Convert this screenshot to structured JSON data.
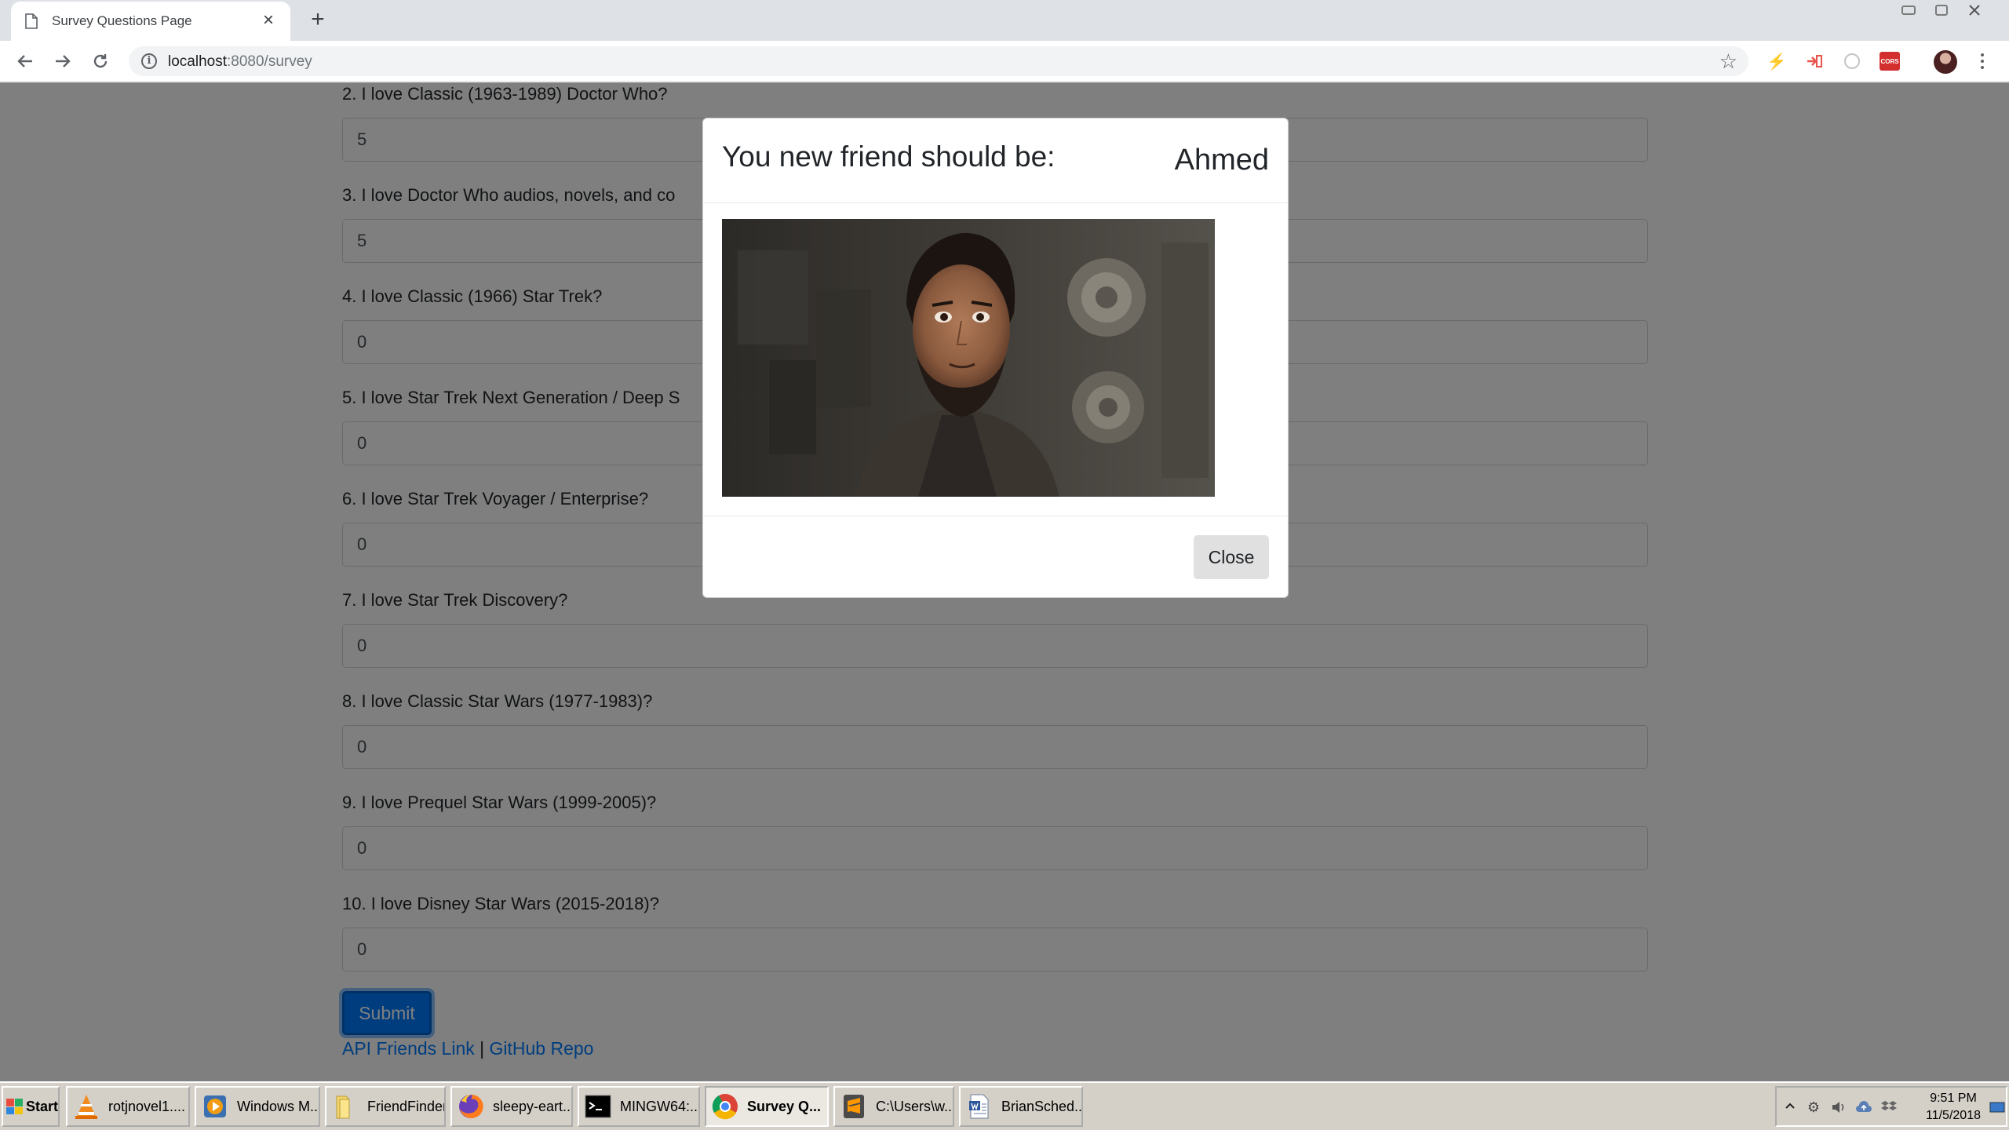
{
  "browser": {
    "tab_title": "Survey Questions Page",
    "url_host": "localhost",
    "url_rest": ":8080/survey",
    "new_tab_label": "+",
    "close_tab_label": "×"
  },
  "survey": {
    "questions": [
      {
        "label": "2. I love Classic (1963-1989) Doctor Who?",
        "value": "5"
      },
      {
        "label": "3. I love Doctor Who audios, novels, and co",
        "value": "5"
      },
      {
        "label": "4. I love Classic (1966) Star Trek?",
        "value": "0"
      },
      {
        "label": "5. I love Star Trek Next Generation / Deep S",
        "value": "0"
      },
      {
        "label": "6. I love Star Trek Voyager / Enterprise?",
        "value": "0"
      },
      {
        "label": "7. I love Star Trek Discovery?",
        "value": "0"
      },
      {
        "label": "8. I love Classic Star Wars (1977-1983)?",
        "value": "0"
      },
      {
        "label": "9. I love Prequel Star Wars (1999-2005)?",
        "value": "0"
      },
      {
        "label": "10. I love Disney Star Wars (2015-2018)?",
        "value": "0"
      }
    ],
    "submit_label": "Submit",
    "links": {
      "api_label": "API Friends Link",
      "separator": " | ",
      "github_label": "GitHub Repo"
    }
  },
  "modal": {
    "title": "You new friend should be:",
    "friend_name": "Ahmed",
    "close_label": "Close"
  },
  "taskbar": {
    "start_label": "Start",
    "items": [
      {
        "label": "rotjnovel1....",
        "icon": "vlc-icon"
      },
      {
        "label": "Windows M...",
        "icon": "media-player-icon"
      },
      {
        "label": "FriendFinder",
        "icon": "folder-icon"
      },
      {
        "label": "sleepy-eart...",
        "icon": "firefox-icon"
      },
      {
        "label": "MINGW64:...",
        "icon": "terminal-icon"
      },
      {
        "label": "Survey Q...",
        "icon": "chrome-icon"
      },
      {
        "label": "C:\\Users\\w...",
        "icon": "sublime-icon"
      },
      {
        "label": "BrianSched...",
        "icon": "document-icon"
      }
    ],
    "clock_time": "9:51 PM",
    "clock_date": "11/5/2018"
  }
}
